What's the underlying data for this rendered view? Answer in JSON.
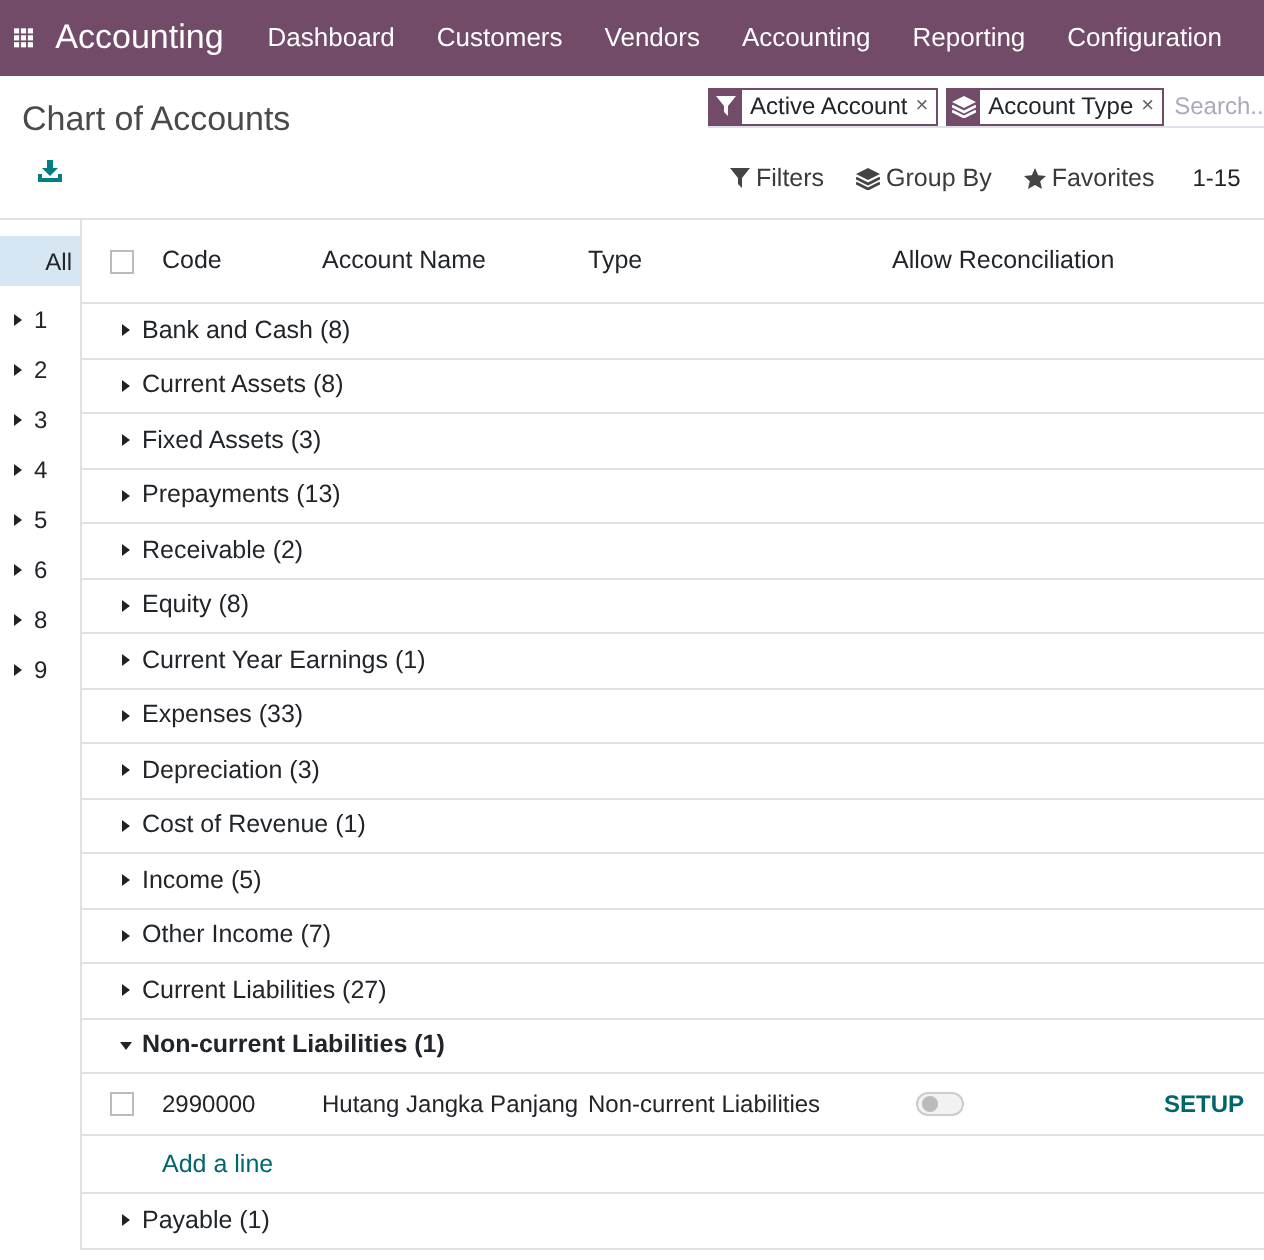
{
  "navbar": {
    "app_title": "Accounting",
    "menu": [
      "Dashboard",
      "Customers",
      "Vendors",
      "Accounting",
      "Reporting",
      "Configuration"
    ]
  },
  "control_panel": {
    "title": "Chart of Accounts",
    "facets": [
      {
        "kind": "filter",
        "label": "Active Account",
        "remove": "×"
      },
      {
        "kind": "group",
        "label": "Account Type",
        "remove": "×"
      }
    ],
    "search": {
      "placeholder": "Search..."
    },
    "buttons": [
      {
        "kind": "filter",
        "label": "Filters"
      },
      {
        "kind": "group",
        "label": "Group By"
      },
      {
        "kind": "star",
        "label": "Favorites"
      }
    ],
    "pager": "1-15"
  },
  "side_panel": [
    {
      "label": "All",
      "selected": true,
      "expandable": false
    },
    {
      "label": "1",
      "selected": false,
      "expandable": true
    },
    {
      "label": "2",
      "selected": false,
      "expandable": true
    },
    {
      "label": "3",
      "selected": false,
      "expandable": true
    },
    {
      "label": "4",
      "selected": false,
      "expandable": true
    },
    {
      "label": "5",
      "selected": false,
      "expandable": true
    },
    {
      "label": "6",
      "selected": false,
      "expandable": true
    },
    {
      "label": "8",
      "selected": false,
      "expandable": true
    },
    {
      "label": "9",
      "selected": false,
      "expandable": true
    }
  ],
  "table": {
    "select_all_checked": false,
    "columns": [
      "Code",
      "Account Name",
      "Type",
      "Allow Reconciliation"
    ],
    "groups": [
      {
        "label": "Bank and Cash (8)",
        "expanded": false
      },
      {
        "label": "Current Assets (8)",
        "expanded": false
      },
      {
        "label": "Fixed Assets (3)",
        "expanded": false
      },
      {
        "label": "Prepayments (13)",
        "expanded": false
      },
      {
        "label": "Receivable (2)",
        "expanded": false
      },
      {
        "label": "Equity (8)",
        "expanded": false
      },
      {
        "label": "Current Year Earnings (1)",
        "expanded": false
      },
      {
        "label": "Expenses (33)",
        "expanded": false
      },
      {
        "label": "Depreciation (3)",
        "expanded": false
      },
      {
        "label": "Cost of Revenue (1)",
        "expanded": false
      },
      {
        "label": "Income (5)",
        "expanded": false
      },
      {
        "label": "Other Income (7)",
        "expanded": false
      },
      {
        "label": "Current Liabilities (27)",
        "expanded": false
      },
      {
        "label": "Non-current Liabilities (1)",
        "expanded": true,
        "rows": [
          {
            "checked": false,
            "code": "2990000",
            "name": "Hutang Jangka Panjang",
            "type": "Non-current Liabilities",
            "allow_reconciliation": false,
            "action": "SETUP"
          }
        ],
        "add_line": "Add a line"
      },
      {
        "label": "Payable (1)",
        "expanded": false
      }
    ]
  }
}
